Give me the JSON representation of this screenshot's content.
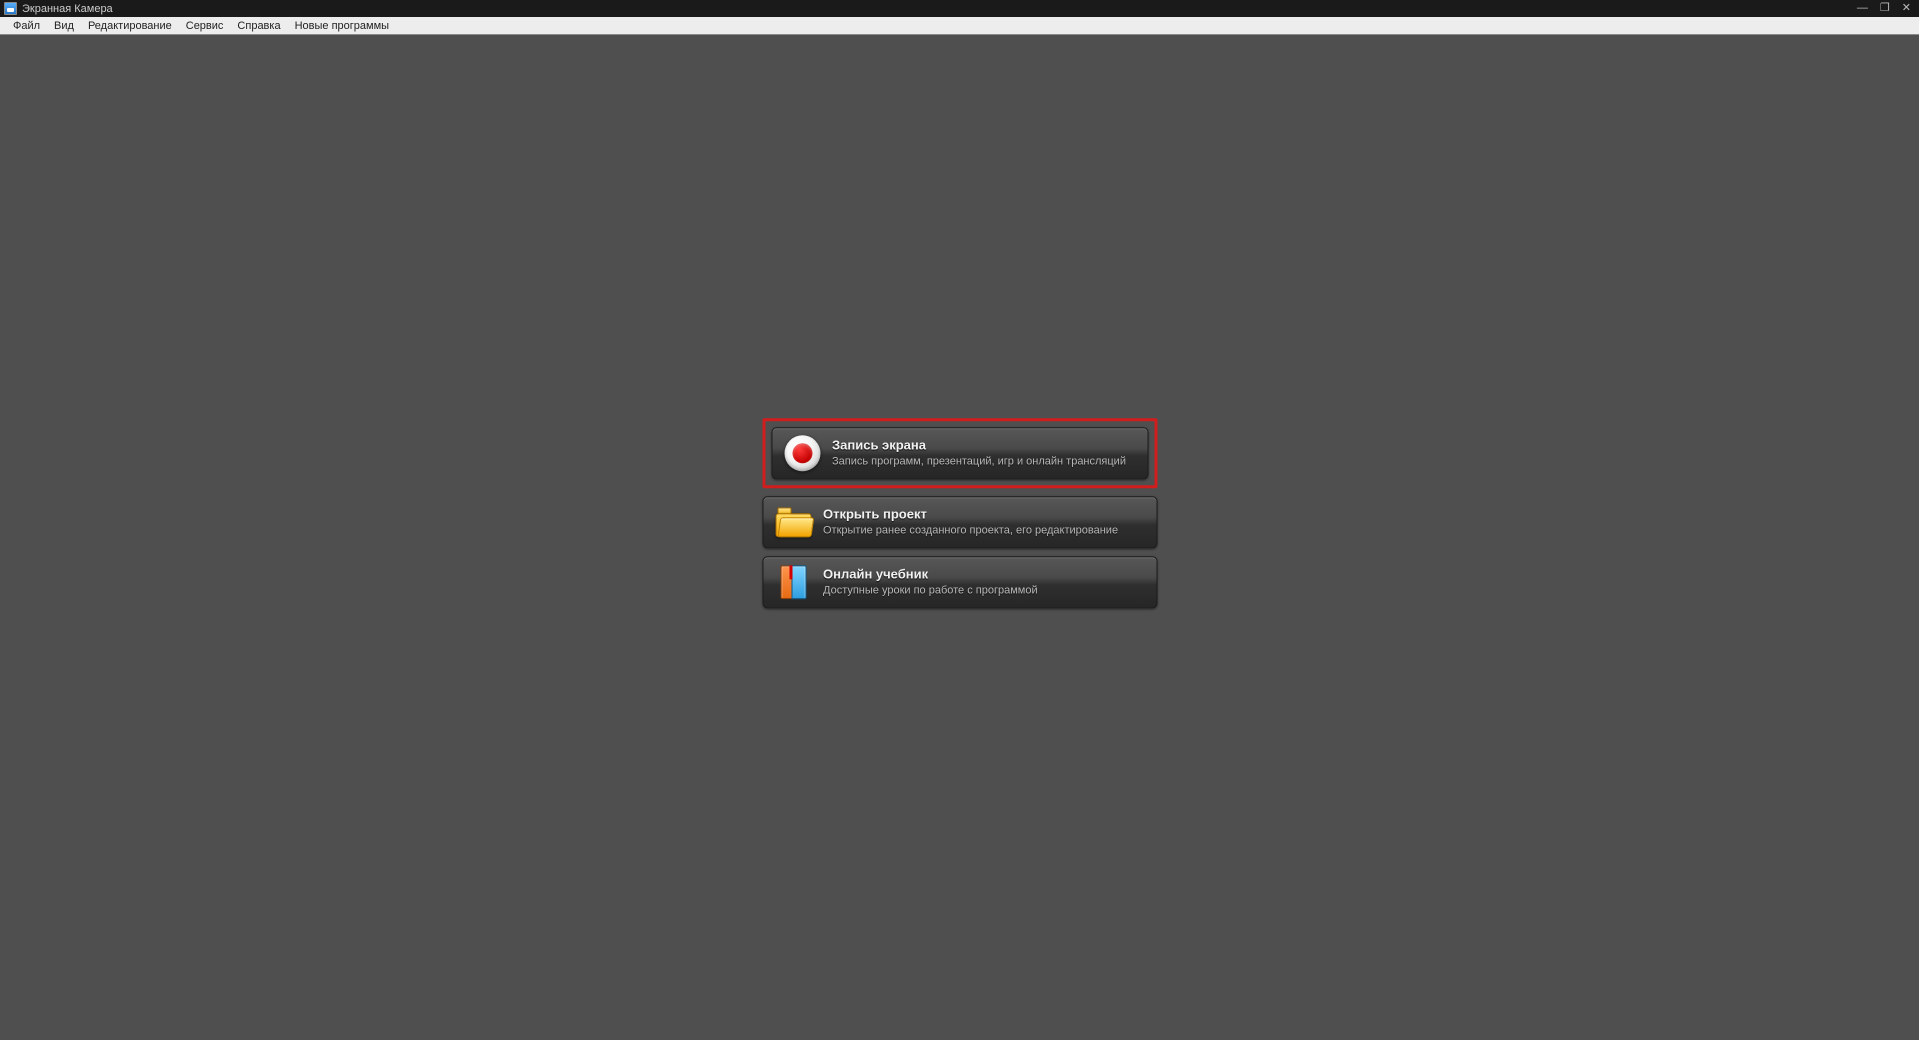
{
  "window": {
    "title": "Экранная Камера"
  },
  "menu": [
    "Файл",
    "Вид",
    "Редактирование",
    "Сервис",
    "Справка",
    "Новые программы"
  ],
  "buttons": {
    "record": {
      "title": "Запись экрана",
      "subtitle": "Запись программ, презентаций, игр и онлайн трансляций"
    },
    "open": {
      "title": "Открыть проект",
      "subtitle": "Открытие ранее созданного проекта, его редактирование"
    },
    "tutorial": {
      "title": "Онлайн учебник",
      "subtitle": "Доступные уроки по работе с программой"
    }
  }
}
